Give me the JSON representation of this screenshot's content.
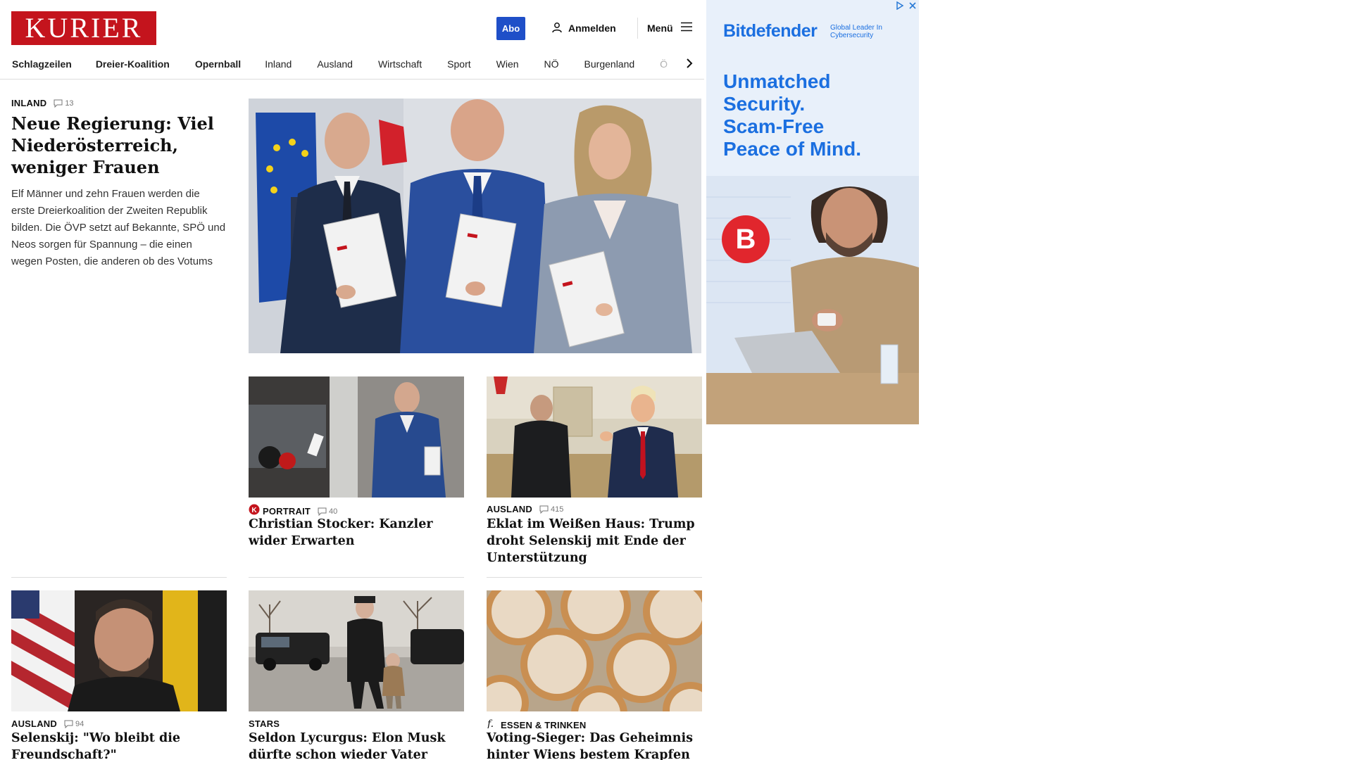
{
  "header": {
    "logo": "KURIER",
    "abo_label": "Abo",
    "login_label": "Anmelden",
    "menu_label": "Menü"
  },
  "nav": {
    "items": [
      "Schlagzeilen",
      "Dreier-Koalition",
      "Opernball",
      "Inland",
      "Ausland",
      "Wirtschaft",
      "Sport",
      "Wien",
      "NÖ",
      "Burgenland",
      "Ö"
    ]
  },
  "lead": {
    "category": "INLAND",
    "comments": "13",
    "title": "Neue Regierung: Viel Niederösterreich, weniger Frauen",
    "teaser": "Elf Männer und zehn Frauen werden die erste Dreierkoalition der Zweiten Republik bilden. Die ÖVP setzt auf Bekannte, SPÖ und Neos sorgen für Spannung – die einen wegen Posten, die anderen ob des Votums"
  },
  "cards": [
    {
      "category": "PORTRAIT",
      "comments": "40",
      "title": "Christian Stocker: Kanzler wider Erwarten"
    },
    {
      "category": "AUSLAND",
      "comments": "415",
      "title": "Eklat im Weißen Haus: Trump droht Selenskij mit Ende der Unterstützung"
    },
    {
      "category": "AUSLAND",
      "comments": "94",
      "title": "Selenskij: \"Wo bleibt die Freundschaft?\""
    },
    {
      "category": "STARS",
      "comments": "",
      "title": "Seldon Lycurgus: Elon Musk dürfte schon wieder Vater geworden sein"
    },
    {
      "category": "ESSEN & TRINKEN",
      "comments": "",
      "title": "Voting-Sieger: Das Geheimnis hinter Wiens bestem Krapfen"
    }
  ],
  "ad": {
    "brand": "Bitdefender",
    "tagline": "Global Leader In Cybersecurity",
    "headline": "Unmatched Security. Scam-Free Peace of Mind.",
    "badge": "B"
  },
  "colors": {
    "brand_red": "#c4141d",
    "abo_blue": "#1f4fc8",
    "ad_blue": "#1b6fe0"
  }
}
